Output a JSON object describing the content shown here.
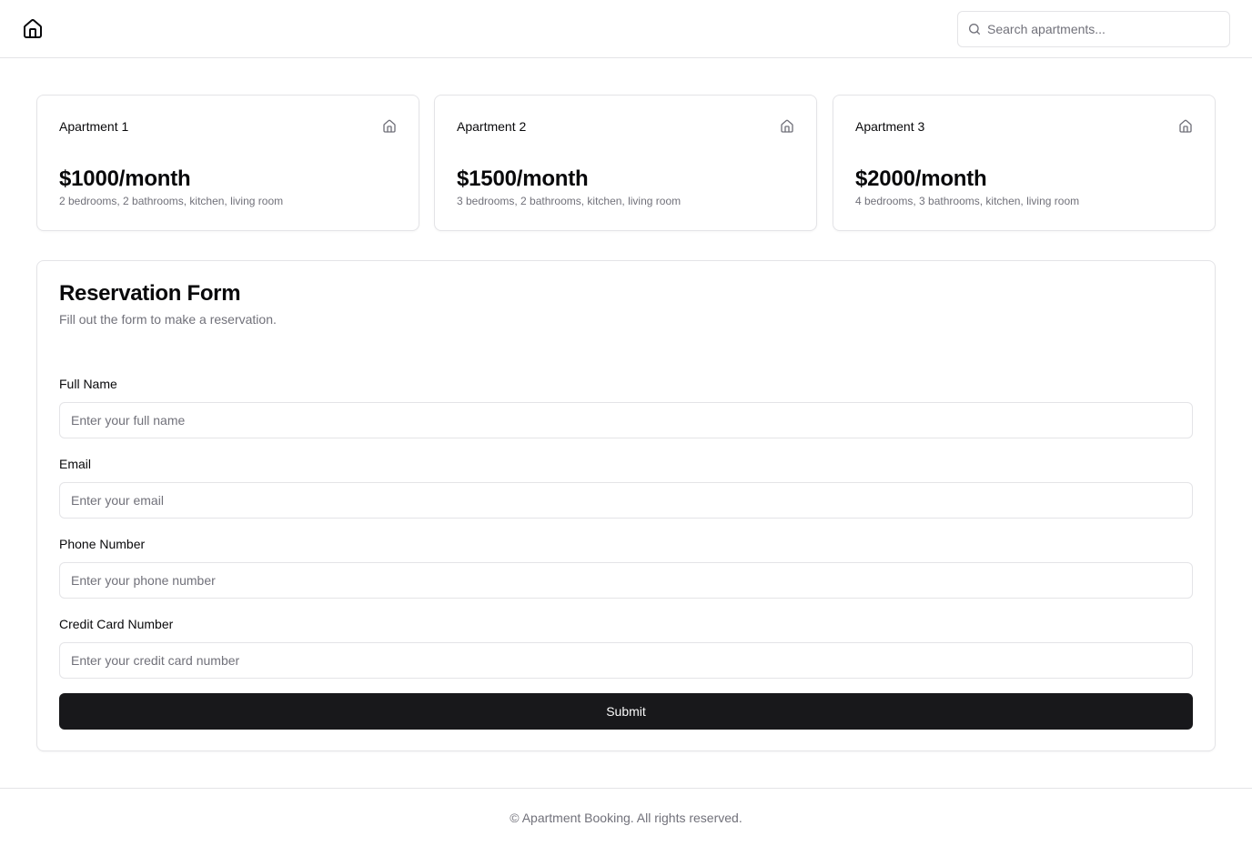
{
  "header": {
    "logo_icon": "home-icon",
    "search": {
      "icon": "search-icon",
      "placeholder": "Search apartments..."
    }
  },
  "apartments": [
    {
      "title": "Apartment 1",
      "icon": "home-icon",
      "price": "$1000/month",
      "description": "2 bedrooms, 2 bathrooms, kitchen, living room"
    },
    {
      "title": "Apartment 2",
      "icon": "home-icon",
      "price": "$1500/month",
      "description": "3 bedrooms, 2 bathrooms, kitchen, living room"
    },
    {
      "title": "Apartment 3",
      "icon": "home-icon",
      "price": "$2000/month",
      "description": "4 bedrooms, 3 bathrooms, kitchen, living room"
    }
  ],
  "form": {
    "title": "Reservation Form",
    "subtitle": "Fill out the form to make a reservation.",
    "fields": [
      {
        "label": "Full Name",
        "placeholder": "Enter your full name",
        "value": ""
      },
      {
        "label": "Email",
        "placeholder": "Enter your email",
        "value": ""
      },
      {
        "label": "Phone Number",
        "placeholder": "Enter your phone number",
        "value": ""
      },
      {
        "label": "Credit Card Number",
        "placeholder": "Enter your credit card number",
        "value": ""
      }
    ],
    "submit_label": "Submit"
  },
  "footer": {
    "text": "© Apartment Booking. All rights reserved."
  },
  "colors": {
    "primary": "#18181b",
    "muted_text": "#71717a",
    "border": "#e4e4e7",
    "background": "#ffffff"
  }
}
